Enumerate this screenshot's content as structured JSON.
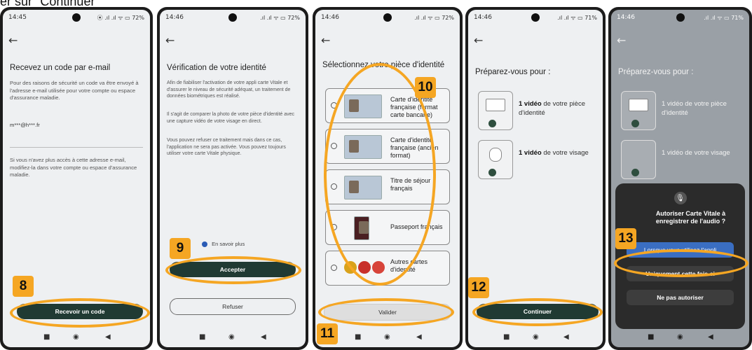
{
  "caption": "er sur \"Continuer\"",
  "screen1": {
    "time": "14:45",
    "status_icons": "⦿ .ıl .ıl ᯤ ▭ 72%",
    "title": "Recevez un code par e-mail",
    "body": "Pour des raisons de sécurité un code va être envoyé à l'adresse e-mail utilisée pour votre compte ou espace d'assurance maladie.",
    "email": "m***@h***.fr",
    "info": "Si vous n'avez plus accès à cette adresse e-mail, modifiez-la dans votre compte ou espace d'assurance maladie.",
    "button": "Recevoir un code",
    "badge": "8"
  },
  "screen2": {
    "time": "14:46",
    "status_icons": ".ıl .ıl ᯤ ▭ 72%",
    "title": "Vérification de votre identité",
    "p1": "Afin de fiabiliser l'activation de votre appli carte Vitale et d'assurer le niveau de sécurité adéquat, un traitement de données biométriques est réalisé.",
    "p2": "Il s'agit de comparer la photo de votre pièce d'identité avec une capture vidéo de votre visage en direct.",
    "p3": "Vous pouvez refuser ce traitement mais dans ce cas, l'application ne sera pas activée. Vous pouvez toujours utiliser votre carte Vitale physique.",
    "learn_more": "En savoir plus",
    "accept": "Accepter",
    "refuse": "Refuser",
    "badge": "9"
  },
  "screen3": {
    "time": "14:46",
    "status_icons": ".ıl .ıl ᯤ ▭ 72%",
    "title": "Sélectionnez votre pièce d'identité",
    "docs": [
      {
        "label": "Carte d'identité française (format carte bancaire)"
      },
      {
        "label": "Carte d'identité française (ancien format)"
      },
      {
        "label": "Titre de séjour français"
      },
      {
        "label": "Passeport français"
      },
      {
        "label": "Autres cartes d'identité"
      }
    ],
    "validate": "Valider",
    "badge_list": "10",
    "badge_validate": "11"
  },
  "screen4": {
    "time": "14:46",
    "status_icons": ".ıl .ıl ᯤ ▭ 71%",
    "title": "Préparez-vous pour :",
    "item1_bold": "1 vidéo",
    "item1_rest": " de votre pièce d'identité",
    "item2_bold": "1 vidéo",
    "item2_rest": " de votre visage",
    "button": "Continuer",
    "badge": "12"
  },
  "screen5": {
    "time": "14:46",
    "status_icons": ".ıl .ıl ᯤ ▭ 71%",
    "title": "Préparez-vous pour :",
    "item1": "1 vidéo de votre pièce d'identité",
    "item2": "1 vidéo de votre visage",
    "dialog_title": "Autoriser Carte Vitale à enregistrer de l'audio ?",
    "opt1": "Lorsque vous utilisez l'appli",
    "opt2": "Uniquement cette fois-ci",
    "opt3": "Ne pas autoriser",
    "badge": "13"
  },
  "nav": {
    "square": "■",
    "circle": "◉",
    "back": "◀"
  },
  "back_arrow": "←"
}
